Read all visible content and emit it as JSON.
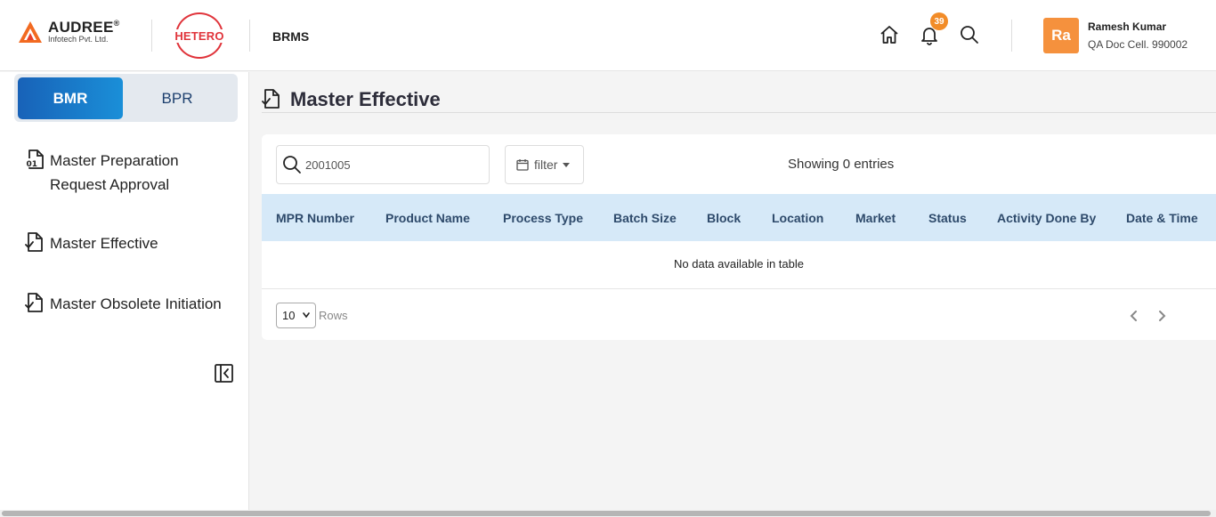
{
  "header": {
    "brand_name": "AUDREE",
    "brand_reg": "®",
    "brand_sub": "Infotech Pvt. Ltd.",
    "partner_logo": "HETERO",
    "app_name": "BRMS",
    "notification_count": "39",
    "icons": [
      "home-icon",
      "bell-icon",
      "search-icon"
    ],
    "user": {
      "initials": "Ra",
      "name": "Ramesh Kumar",
      "role": "QA Doc Cell. 990002"
    }
  },
  "sidebar": {
    "segments": [
      {
        "label": "BMR",
        "active": true
      },
      {
        "label": "BPR",
        "active": false
      }
    ],
    "items": [
      {
        "label_line1": "Master Preparation",
        "label_line2": "Request Approval",
        "icon": "document-01-icon"
      },
      {
        "label": "Master Effective",
        "icon": "document-check-icon"
      },
      {
        "label": "Master Obsolete Initiation",
        "icon": "document-check-icon"
      }
    ]
  },
  "main": {
    "title": "Master Effective",
    "search": {
      "value": "2001005",
      "placeholder": ""
    },
    "filter_label": "filter",
    "showing": "Showing 0 entries",
    "columns": [
      "MPR Number",
      "Product Name",
      "Process Type",
      "Batch Size",
      "Block",
      "Location",
      "Market",
      "Status",
      "Activity Done By",
      "Date & Time"
    ],
    "empty_message": "No data available in table",
    "rows_value": "10",
    "rows_label": "Rows"
  },
  "colors": {
    "accent_blue": "#1a8fd8",
    "header_row": "#d6e9f8",
    "badge": "#f28c28",
    "avatar": "#f5913d",
    "hetero_red": "#e0343b"
  }
}
